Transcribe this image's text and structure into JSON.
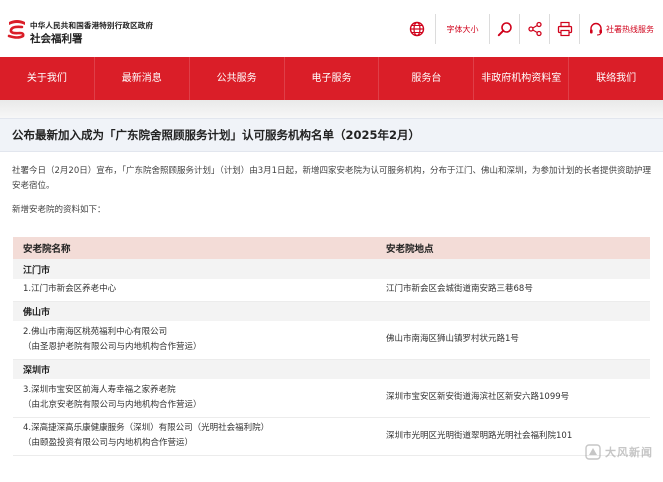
{
  "header": {
    "gov_name": "中华人民共和国香港特别行政区政府",
    "dept_name": "社会福利署",
    "tools": {
      "font_size_label": "字体大小",
      "hotline_label": "社署热线服务"
    },
    "accent_color": "#da1e28"
  },
  "nav": {
    "items": [
      {
        "label": "关于我们"
      },
      {
        "label": "最新消息"
      },
      {
        "label": "公共服务"
      },
      {
        "label": "电子服务"
      },
      {
        "label": "服务台"
      },
      {
        "label": "非政府机构资料室"
      },
      {
        "label": "联络我们"
      }
    ]
  },
  "article": {
    "title": "公布最新加入成为「广东院舍照顾服务计划」认可服务机构名单（2025年2月）",
    "paragraph": "社署今日（2月20日）宣布，「广东院舍照顾服务计划」（计划）由3月1日起，新增四家安老院为认可服务机构，分布于江门、佛山和深圳，为参加计划的长者提供资助护理安老宿位。",
    "subheading": "新增安老院的资料如下："
  },
  "table": {
    "headers": [
      "安老院名称",
      "安老院地点"
    ],
    "groups": [
      {
        "region": "江门市",
        "rows": [
          {
            "name": [
              "1.江门市新会区养老中心"
            ],
            "address": "江门市新会区会城街道南安路三巷68号"
          }
        ]
      },
      {
        "region": "佛山市",
        "rows": [
          {
            "name": [
              "2.佛山市南海区桃苑福利中心有限公司",
              "（由圣恩护老院有限公司与内地机构合作营运）"
            ],
            "address": "佛山市南海区狮山镇罗村状元路1号"
          }
        ]
      },
      {
        "region": "深圳市",
        "rows": [
          {
            "name": [
              "3.深圳市宝安区前海人寿幸福之家养老院",
              "（由北京安老院有限公司与内地机构合作营运）"
            ],
            "address": "深圳市宝安区新安街道海滨社区新安六路1099号"
          },
          {
            "name": [
              "4.深高捷深高乐康健康服务（深圳）有限公司（光明社会福利院）",
              "（由颐盈投资有限公司与内地机构合作营运）"
            ],
            "address": "深圳市光明区光明街道翠明路光明社会福利院101"
          }
        ]
      }
    ]
  },
  "watermark": {
    "text": "大风新闻"
  }
}
